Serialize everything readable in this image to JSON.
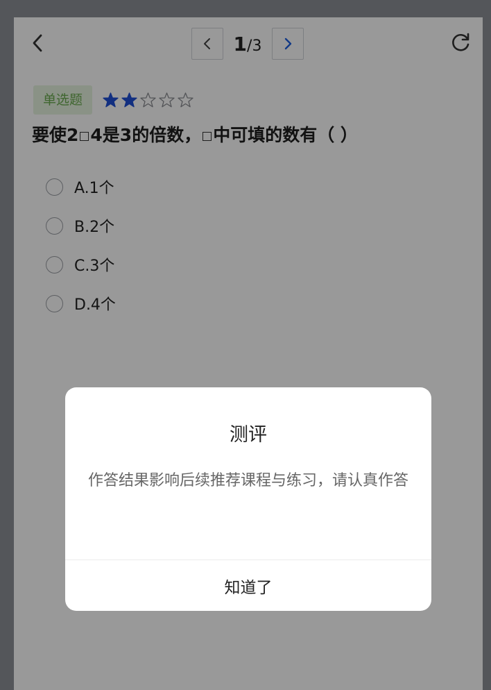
{
  "pager": {
    "current": "1",
    "total": "/3"
  },
  "question": {
    "type_tag": "单选题",
    "difficulty": {
      "filled": 2,
      "total": 5
    },
    "text_before": "要使2",
    "text_after": "4是3的倍数，",
    "text_end": "中可填的数有（  ）",
    "options": [
      "A.1个",
      "B.2个",
      "C.3个",
      "D.4个"
    ]
  },
  "dialog": {
    "title": "测评",
    "message": "作答结果影响后续推荐课程与练习，请认真作答",
    "button": "知道了"
  },
  "colors": {
    "accent": "#1f5fe0",
    "tag_bg": "#e6f3e0",
    "tag_text": "#6aab4f",
    "star_filled": "#1f4fd6"
  },
  "icons": {
    "back": "chevron-left-icon",
    "prev": "chevron-left-icon",
    "next": "chevron-right-icon",
    "refresh": "refresh-icon",
    "star": "star-icon"
  }
}
